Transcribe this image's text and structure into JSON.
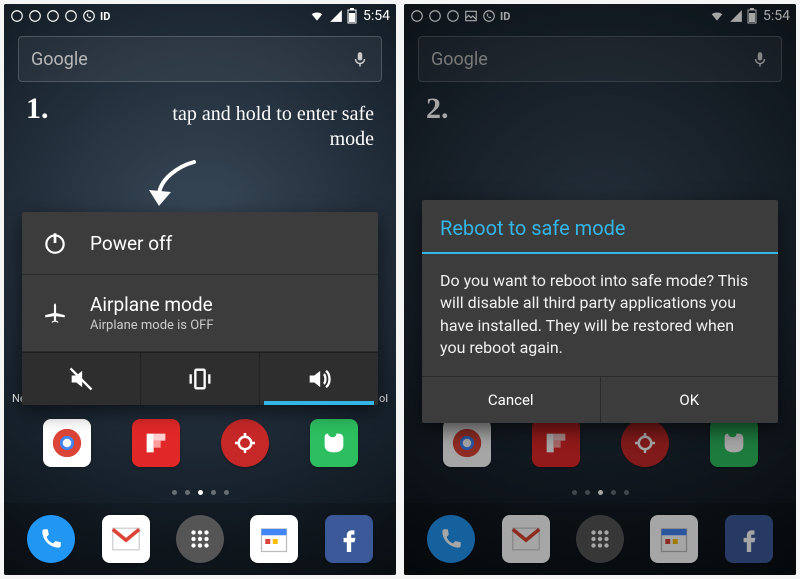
{
  "statusBar": {
    "time": "5:54"
  },
  "search": {
    "placeholder": "Google"
  },
  "annotations": {
    "step1": "1.",
    "step2": "2.",
    "hint": "tap and hold to enter safe mode"
  },
  "powerMenu": {
    "powerOff": {
      "label": "Power off"
    },
    "airplane": {
      "label": "Airplane mode",
      "status": "Airplane mode is OFF"
    }
  },
  "dialog": {
    "title": "Reboot to safe mode",
    "body": "Do you want to reboot into safe mode? This will disable all third party applications you have installed. They will be restored when you reboot again.",
    "cancel": "Cancel",
    "ok": "OK"
  },
  "homeLabels": {
    "left": "Ne",
    "right": "ol"
  },
  "colors": {
    "holoBlue": "#33b5e5",
    "phoneBlue": "#2196f3",
    "gmailRed": "#db4437",
    "chrome": "#ffffff",
    "flipboard": "#e12828",
    "evernote": "#2dbe60",
    "facebook": "#3b5998",
    "apps": "#555"
  }
}
